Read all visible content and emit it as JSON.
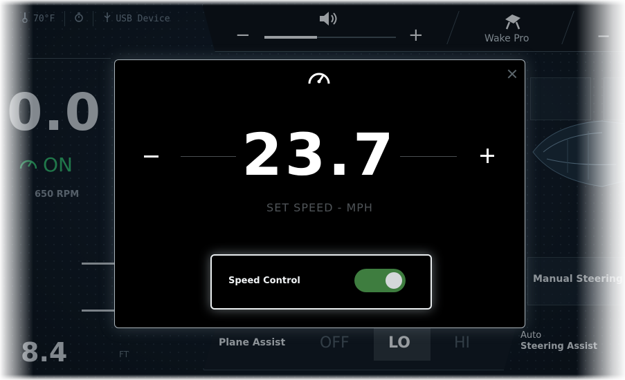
{
  "status_bar": {
    "temperature": "70°F",
    "device": "USB Device"
  },
  "volume": {
    "minus": "−",
    "plus": "+",
    "level": 0.4
  },
  "wake": {
    "label": "Wake Pro"
  },
  "right_control": {
    "minus": "−"
  },
  "background": {
    "speed_value": "0.0",
    "cruise_status": "ON",
    "rpm": "650 RPM",
    "depth_value": "8.4",
    "depth_unit": "FT",
    "manual_steering": "Manual Steering",
    "auto_steer_line1": "Auto",
    "auto_steer_line2": "Steering Assist",
    "plane_assist": {
      "label": "Plane Assist",
      "options": [
        "OFF",
        "LO",
        "HI"
      ],
      "selected": "LO"
    }
  },
  "modal": {
    "set_speed": "23.7",
    "set_speed_label": "SET SPEED - MPH",
    "speed_control_label": "Speed Control",
    "speed_control_on": true
  },
  "colors": {
    "accent_green": "#3e7d3f",
    "on_green": "#2fb36b",
    "background": "#0f1b26"
  }
}
